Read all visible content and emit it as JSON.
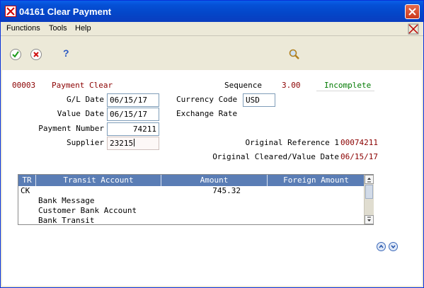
{
  "window": {
    "app_id": "04161",
    "title": "Clear Payment"
  },
  "menu": {
    "functions": "Functions",
    "tools": "Tools",
    "help": "Help"
  },
  "toolbar": {
    "ok": "check-icon",
    "cancel": "cancel-icon",
    "help": "?",
    "search": "search-icon"
  },
  "header": {
    "document_number": "00003",
    "document_label": "Payment Clear",
    "sequence_label": "Sequence",
    "sequence_value": "3.00",
    "status": "Incomplete"
  },
  "form": {
    "gl_date_label": "G/L Date",
    "gl_date_value": "06/15/17",
    "value_date_label": "Value Date",
    "value_date_value": "06/15/17",
    "payment_number_label": "Payment Number",
    "payment_number_value": "74211",
    "supplier_label": "Supplier",
    "supplier_value": "23215",
    "currency_code_label": "Currency Code",
    "currency_code_value": "USD",
    "exchange_rate_label": "Exchange Rate",
    "original_reference_label": "Original Reference 1",
    "original_reference_value": "00074211",
    "original_cleared_label": "Original Cleared/Value Date",
    "original_cleared_value": "06/15/17"
  },
  "grid": {
    "columns": [
      "TR",
      "Transit Account",
      "Amount",
      "Foreign Amount"
    ],
    "rows": [
      {
        "tr": "CK",
        "transit_account": "",
        "amount": "745.32",
        "foreign_amount": ""
      }
    ],
    "sub_lines": [
      "Bank Message",
      "Customer Bank Account",
      "Bank Transit"
    ]
  },
  "colors": {
    "titlebar": "#0550d6",
    "grid_header": "#5a7db5",
    "status_green": "#007a00",
    "value_red": "#8b0000"
  }
}
